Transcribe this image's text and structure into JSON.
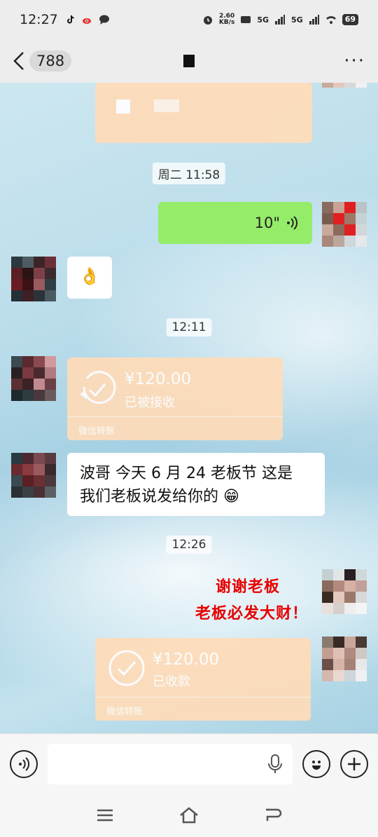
{
  "status_bar": {
    "time": "12:27",
    "net_speed_value": "2.60",
    "net_speed_unit": "KB/s",
    "network_1": "5G",
    "network_2": "5G",
    "battery": "69"
  },
  "header": {
    "back_count": "788",
    "more_label": "···"
  },
  "messages": {
    "ts_1": "周二 11:58",
    "voice_duration": "10\"",
    "emoji_reply": "👌",
    "ts_2": "12:11",
    "transfer_1_amount": "¥120.00",
    "transfer_1_state": "已被接收",
    "transfer_1_footer": "微信转账",
    "text_msg_line1": "波哥 今天 6 月 24 老板节 这是",
    "text_msg_line2": "我们老板说发给你的 😁",
    "ts_3": "12:26",
    "overlay_line1": "谢谢老板",
    "overlay_line2": "老板必发大财！",
    "transfer_2_amount": "¥120.00",
    "transfer_2_state": "已收款",
    "transfer_2_footer": "微信转账"
  },
  "colors": {
    "voice_bubble": "#95ec69",
    "transfer_bubble": "#ffdcb9",
    "overlay_text": "#e60000"
  }
}
